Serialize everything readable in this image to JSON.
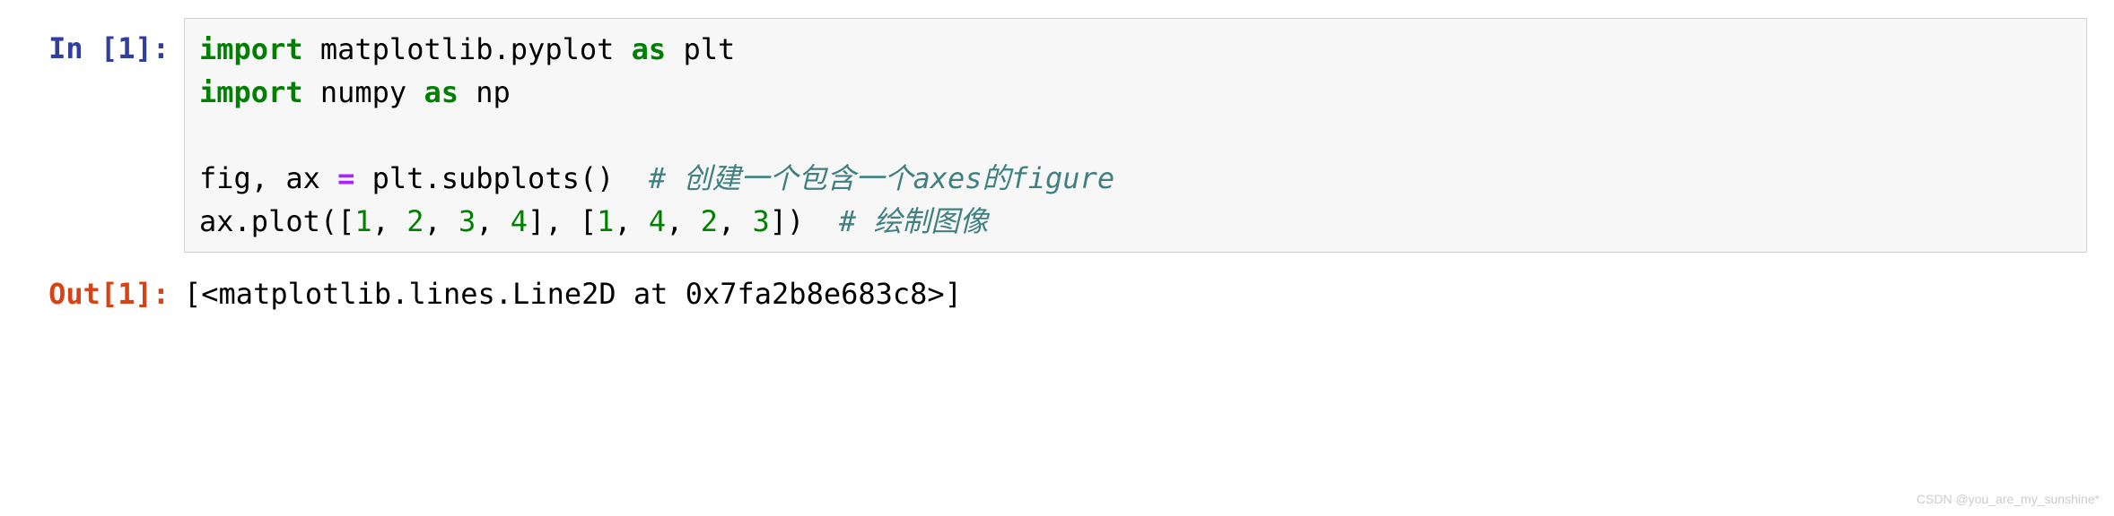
{
  "cell_in": {
    "prompt": "In [1]:",
    "tokens": {
      "import1": "import",
      "t1": " matplotlib.pyplot ",
      "as1": "as",
      "t2": " plt\n",
      "import2": "import",
      "t3": " numpy ",
      "as2": "as",
      "t4": " np\n\nfig, ax ",
      "eq": "=",
      "t5": " plt.subplots()  ",
      "c1": "# 创建一个包含一个axes的figure",
      "t6": "\nax.plot([",
      "n1": "1",
      "t7": ", ",
      "n2": "2",
      "t8": ", ",
      "n3": "3",
      "t9": ", ",
      "n4": "4",
      "t10": "], [",
      "n5": "1",
      "t11": ", ",
      "n6": "4",
      "t12": ", ",
      "n7": "2",
      "t13": ", ",
      "n8": "3",
      "t14": "])  ",
      "c2": "# 绘制图像"
    }
  },
  "cell_out": {
    "prompt": "Out[1]:",
    "text": "[<matplotlib.lines.Line2D at 0x7fa2b8e683c8>]"
  },
  "watermark": "CSDN @you_are_my_sunshine*"
}
